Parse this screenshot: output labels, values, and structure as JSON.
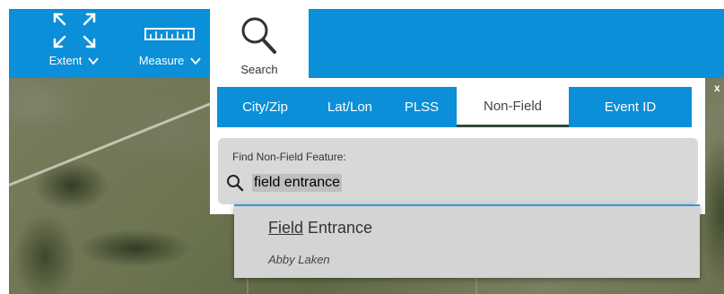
{
  "toolbar": {
    "extent_label": "Extent",
    "measure_label": "Measure",
    "search_label": "Search",
    "accent_color": "#0a8fd8",
    "icons": {
      "extent": "expand-arrows-icon",
      "measure": "ruler-icon",
      "search": "magnifier-icon",
      "chevron": "chevron-down-icon"
    }
  },
  "search": {
    "tabs": [
      {
        "label": "City/Zip",
        "active": false
      },
      {
        "label": "Lat/Lon",
        "active": false
      },
      {
        "label": "PLSS",
        "active": false
      },
      {
        "label": "Non-Field",
        "active": true
      },
      {
        "label": "Event ID",
        "active": false
      }
    ],
    "close_label": "x",
    "find_label": "Find Non-Field Feature:",
    "query": "field entrance",
    "results": [
      {
        "title_match": "Field",
        "title_rest": " Entrance",
        "subtitle": "Abby Laken"
      }
    ]
  }
}
